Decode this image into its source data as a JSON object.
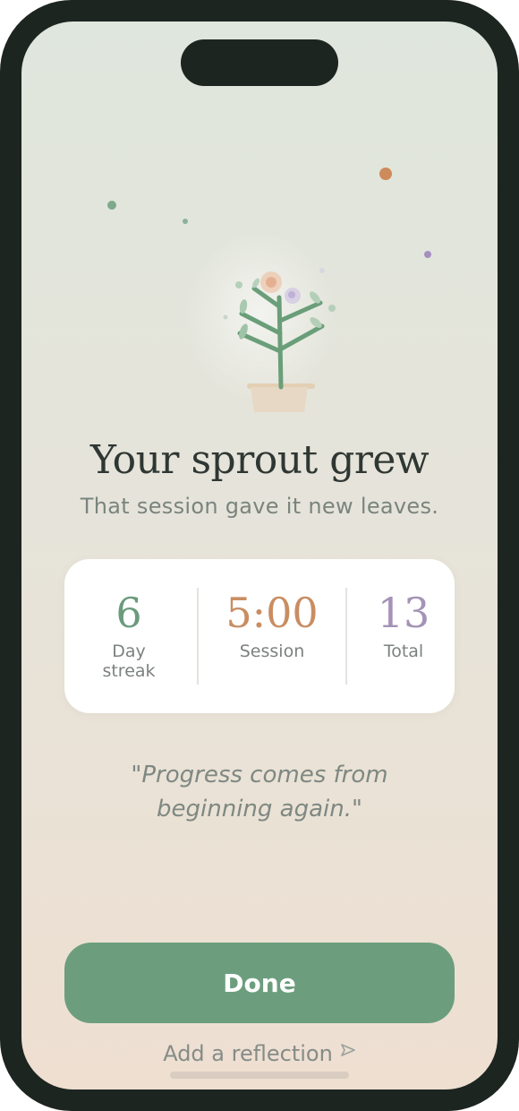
{
  "screen": {
    "title": "Your sprout grew",
    "subtitle": "That session gave it new leaves."
  },
  "stats": [
    {
      "value": "6",
      "label": "Day streak",
      "color": "#6a9b7c"
    },
    {
      "value": "5:00",
      "label": "Session",
      "color": "#c98d62"
    },
    {
      "value": "13",
      "label": "Total",
      "color": "#a593b6"
    }
  ],
  "quote": "\"Progress comes from beginning again.\"",
  "actions": {
    "done_label": "Done",
    "reflection_label": "Add a reflection"
  },
  "icons": {
    "plant": "sprout-illustration-icon",
    "send": "send-arrow-icon"
  },
  "colors": {
    "accent_green": "#6c9e7e",
    "accent_orange": "#c98d62",
    "accent_purple": "#a593b6"
  }
}
